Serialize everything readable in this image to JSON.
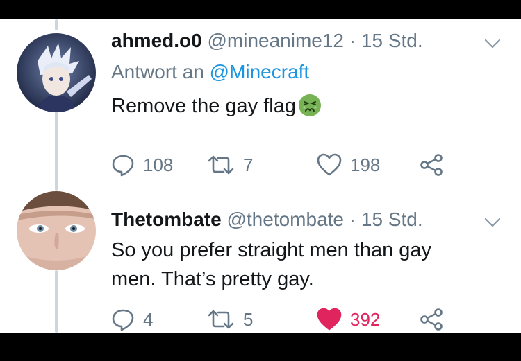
{
  "tweets": [
    {
      "display_name": "ahmed.o0",
      "handle": "@mineanime12",
      "separator": "·",
      "time": "15 Std.",
      "reply_prefix": "Antwort an",
      "reply_mention": "@Minecraft",
      "text": "Remove the gay flag",
      "emoji": "nauseated-face-emoji",
      "replies": "108",
      "retweets": "7",
      "likes": "198",
      "liked": false
    },
    {
      "display_name": "Thetombate",
      "handle": "@thetombate",
      "separator": "·",
      "time": "15 Std.",
      "text_line1": "So you prefer straight men than gay",
      "text_line2": "men. That’s pretty gay.",
      "replies": "4",
      "retweets": "5",
      "likes": "392",
      "liked": true
    }
  ],
  "colors": {
    "text": "#14171a",
    "secondary": "#657786",
    "link": "#1b95e0",
    "like": "#e0245e",
    "thread_line": "#ccd6dd"
  },
  "icons": [
    "reply-icon",
    "retweet-icon",
    "like-icon",
    "share-icon",
    "chevron-down-icon"
  ]
}
